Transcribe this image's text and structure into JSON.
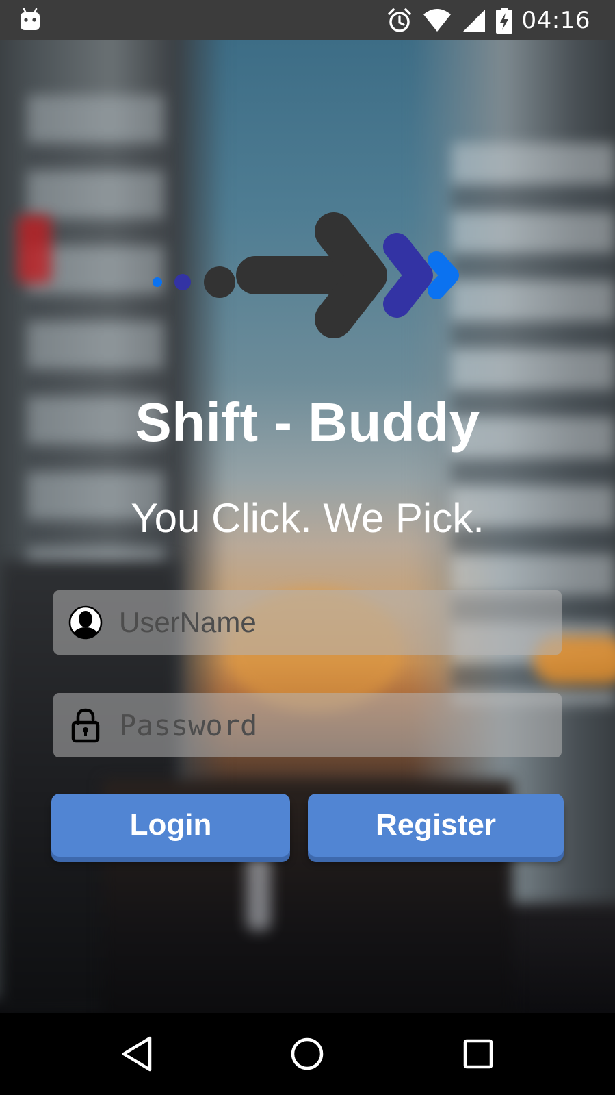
{
  "status_bar": {
    "time": "04:16",
    "icons": [
      "android-icon",
      "alarm-icon",
      "wifi-icon",
      "signal-icon",
      "battery-charging-icon"
    ]
  },
  "app": {
    "title": "Shift - Buddy",
    "tagline": "You Click. We Pick.",
    "logo_icon": "arrow-logo-icon",
    "colors": {
      "logo_dark": "#333333",
      "logo_indigo": "#3333a4",
      "logo_blue": "#0b72f0",
      "button": "#5185d3"
    }
  },
  "form": {
    "username": {
      "placeholder": "UserName",
      "value": "",
      "icon": "user-icon"
    },
    "password": {
      "placeholder": "Password",
      "value": "",
      "icon": "lock-icon"
    },
    "login_label": "Login",
    "register_label": "Register"
  },
  "nav_bar": {
    "buttons": [
      "back-icon",
      "home-icon",
      "recents-icon"
    ]
  }
}
